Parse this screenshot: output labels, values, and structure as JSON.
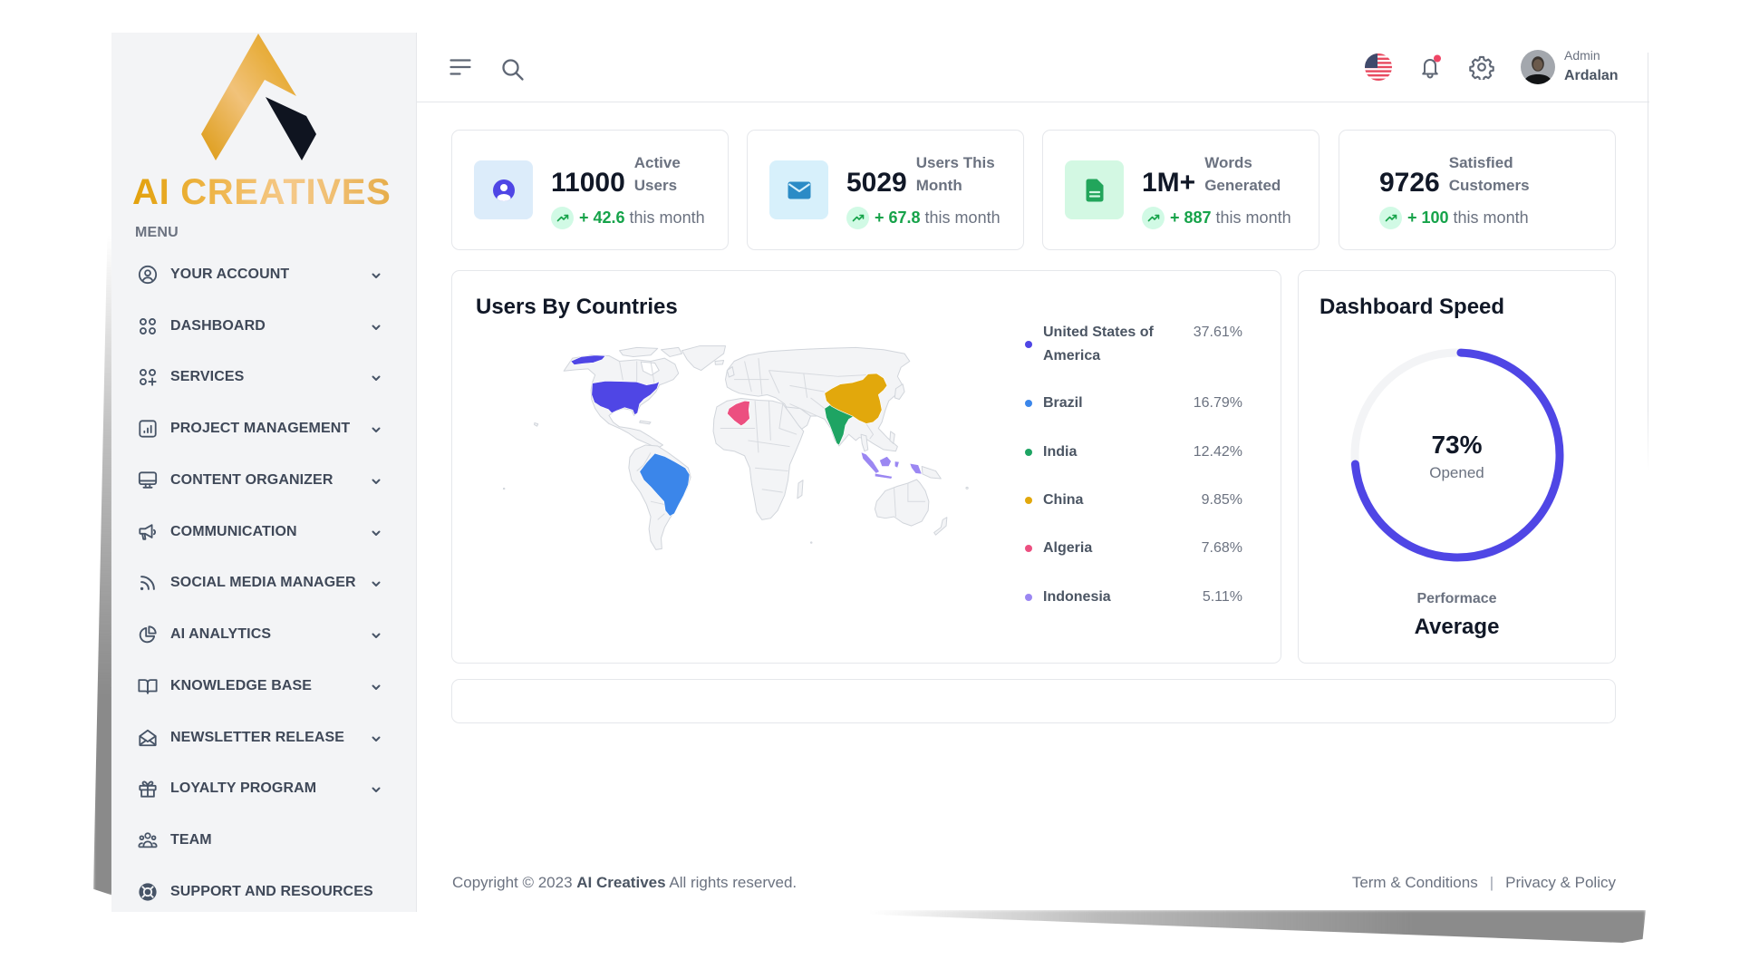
{
  "brand": {
    "name": "AI CREATIVES"
  },
  "sidebar": {
    "menu_label": "MENU",
    "items": [
      {
        "label": "YOUR ACCOUNT",
        "icon": "user-circle-icon",
        "expandable": true
      },
      {
        "label": "DASHBOARD",
        "icon": "grid-icon",
        "expandable": true
      },
      {
        "label": "SERVICES",
        "icon": "grid-plus-icon",
        "expandable": true
      },
      {
        "label": "PROJECT MANAGEMENT",
        "icon": "chart-bar-icon",
        "expandable": true
      },
      {
        "label": "CONTENT ORGANIZER",
        "icon": "monitor-icon",
        "expandable": true
      },
      {
        "label": "COMMUNICATION",
        "icon": "megaphone-icon",
        "expandable": true
      },
      {
        "label": "SOCIAL MEDIA MANAGER",
        "icon": "rss-icon",
        "expandable": true
      },
      {
        "label": "AI ANALYTICS",
        "icon": "pie-chart-icon",
        "expandable": true
      },
      {
        "label": "KNOWLEDGE BASE",
        "icon": "book-open-icon",
        "expandable": true
      },
      {
        "label": "NEWSLETTER RELEASE",
        "icon": "envelope-open-icon",
        "expandable": true
      },
      {
        "label": "LOYALTY PROGRAM",
        "icon": "gift-icon",
        "expandable": true
      },
      {
        "label": "TEAM",
        "icon": "users-group-icon",
        "expandable": false
      },
      {
        "label": "SUPPORT AND RESOURCES",
        "icon": "lifebuoy-icon",
        "expandable": false
      }
    ]
  },
  "header": {
    "icons": [
      "menu-toggle-icon",
      "search-icon",
      "us-flag-icon",
      "bell-icon",
      "gear-icon"
    ],
    "notifications_unread": true,
    "language": "US",
    "user": {
      "role": "Admin",
      "name": "Ardalan"
    }
  },
  "stats": [
    {
      "value": "11000",
      "label": [
        "Active",
        "Users"
      ],
      "change": "+ 42.6",
      "period": "this month",
      "icon": "user-circle-icon"
    },
    {
      "value": "5029",
      "label": [
        "Users This",
        "Month"
      ],
      "change": "+ 67.8",
      "period": "this month",
      "icon": "envelope-icon"
    },
    {
      "value": "1M+",
      "label": [
        "Words",
        "Generated"
      ],
      "change": "+ 887",
      "period": "this month",
      "icon": "document-icon"
    },
    {
      "value": "9726",
      "label": [
        "Satisfied",
        "Customers"
      ],
      "change": "+ 100",
      "period": "this month",
      "icon": null
    }
  ],
  "countries": {
    "title": "Users By Countries",
    "items": [
      {
        "name": "United States of America",
        "percent": "37.61%",
        "color": "#4f46e5"
      },
      {
        "name": "Brazil",
        "percent": "16.79%",
        "color": "#3b86ea"
      },
      {
        "name": "India",
        "percent": "12.42%",
        "color": "#1ea463"
      },
      {
        "name": "China",
        "percent": "9.85%",
        "color": "#e2a80c"
      },
      {
        "name": "Algeria",
        "percent": "7.68%",
        "color": "#ec4f80"
      },
      {
        "name": "Indonesia",
        "percent": "5.11%",
        "color": "#9b87f2"
      }
    ]
  },
  "speed": {
    "title": "Dashboard Speed",
    "value": 73,
    "value_label": "73%",
    "caption": "Opened",
    "performance_label": "Performace",
    "performance_value": "Average"
  },
  "footer": {
    "copyright_prefix": "Copyright © 2023",
    "company": "AI Creatives",
    "copyright_suffix": "All rights reserved.",
    "separator": "|",
    "links": [
      {
        "label": "Term & Conditions"
      },
      {
        "label": "Privacy & Policy"
      }
    ]
  },
  "colors": {
    "accent": "#4f46e5",
    "gauge_track": "#f3f4f6",
    "positive": "#16a34a",
    "notification_dot": "#ef4565",
    "brand_gold": "#e2a10b"
  }
}
